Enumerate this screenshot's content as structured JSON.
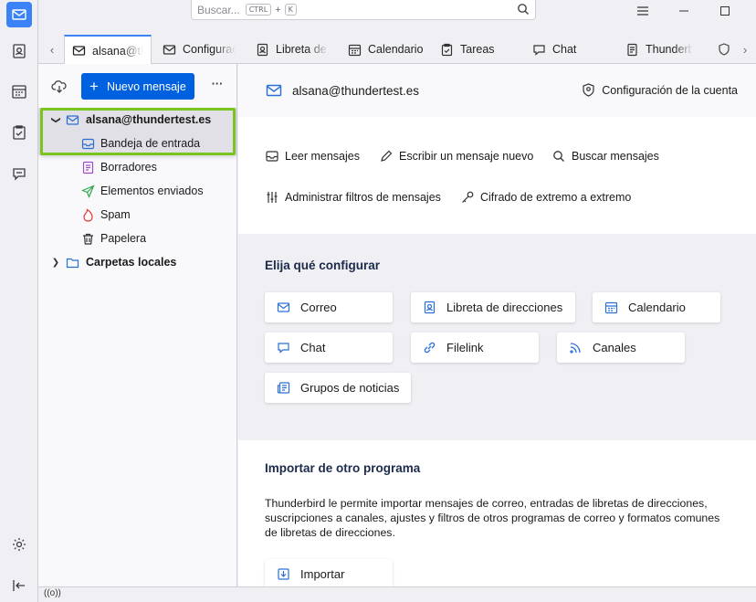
{
  "search": {
    "placeholder": "Buscar...",
    "key1": "CTRL",
    "plus": "+",
    "key2": "K"
  },
  "tabs": [
    {
      "label": "alsana@thundertest.es",
      "icon": "mail-icon"
    },
    {
      "label": "Configuración",
      "icon": "mail-icon"
    },
    {
      "label": "Libreta de direcciones",
      "icon": "address-book-icon"
    },
    {
      "label": "Calendario",
      "icon": "calendar-icon"
    },
    {
      "label": "Tareas",
      "icon": "tasks-icon"
    },
    {
      "label": "Chat",
      "icon": "chat-icon"
    },
    {
      "label": "Thunderbird",
      "icon": "document-icon"
    }
  ],
  "folderpane": {
    "new_message": "Nuevo mensaje",
    "more": "···",
    "account": "alsana@thundertest.es",
    "folders": [
      "Bandeja de entrada",
      "Borradores",
      "Elementos enviados",
      "Spam",
      "Papelera"
    ],
    "local": "Carpetas locales"
  },
  "main": {
    "address": "alsana@thundertest.es",
    "account_settings": "Configuración de la cuenta",
    "actions": {
      "read": "Leer mensajes",
      "write": "Escribir un mensaje nuevo",
      "search": "Buscar mensajes",
      "filters": "Administrar filtros de mensajes",
      "e2e": "Cifrado de extremo a extremo"
    },
    "setup_title": "Elija qué configurar",
    "setup": {
      "mail": "Correo",
      "addressbook": "Libreta de direcciones",
      "calendar": "Calendario",
      "chat": "Chat",
      "filelink": "Filelink",
      "feeds": "Canales",
      "newsgroups": "Grupos de noticias"
    },
    "import_title": "Importar de otro programa",
    "import_text": "Thunderbird le permite importar mensajes de correo, entradas de libretas de direcciones, suscripciones a canales, ajustes y filtros de otros programas de correo y formatos comunes de libretas de direcciones.",
    "import_button": "Importar"
  },
  "status": {
    "signal": "((o))"
  },
  "colors": {
    "accent": "#0061e0",
    "highlight": "#7ac41f"
  }
}
